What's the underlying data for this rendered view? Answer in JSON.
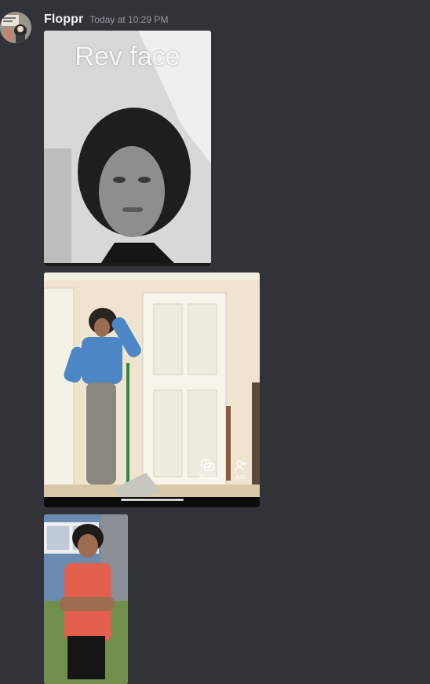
{
  "message": {
    "username": "Floppr",
    "timestamp": "Today at 10:29 PM"
  },
  "attachments": [
    {
      "overlay_text": "Rev face"
    },
    {
      "controls": {
        "media_label": "Media",
        "add_label": "Add"
      }
    },
    {}
  ],
  "icons": [
    "avatar",
    "media-icon",
    "add-person-icon"
  ]
}
